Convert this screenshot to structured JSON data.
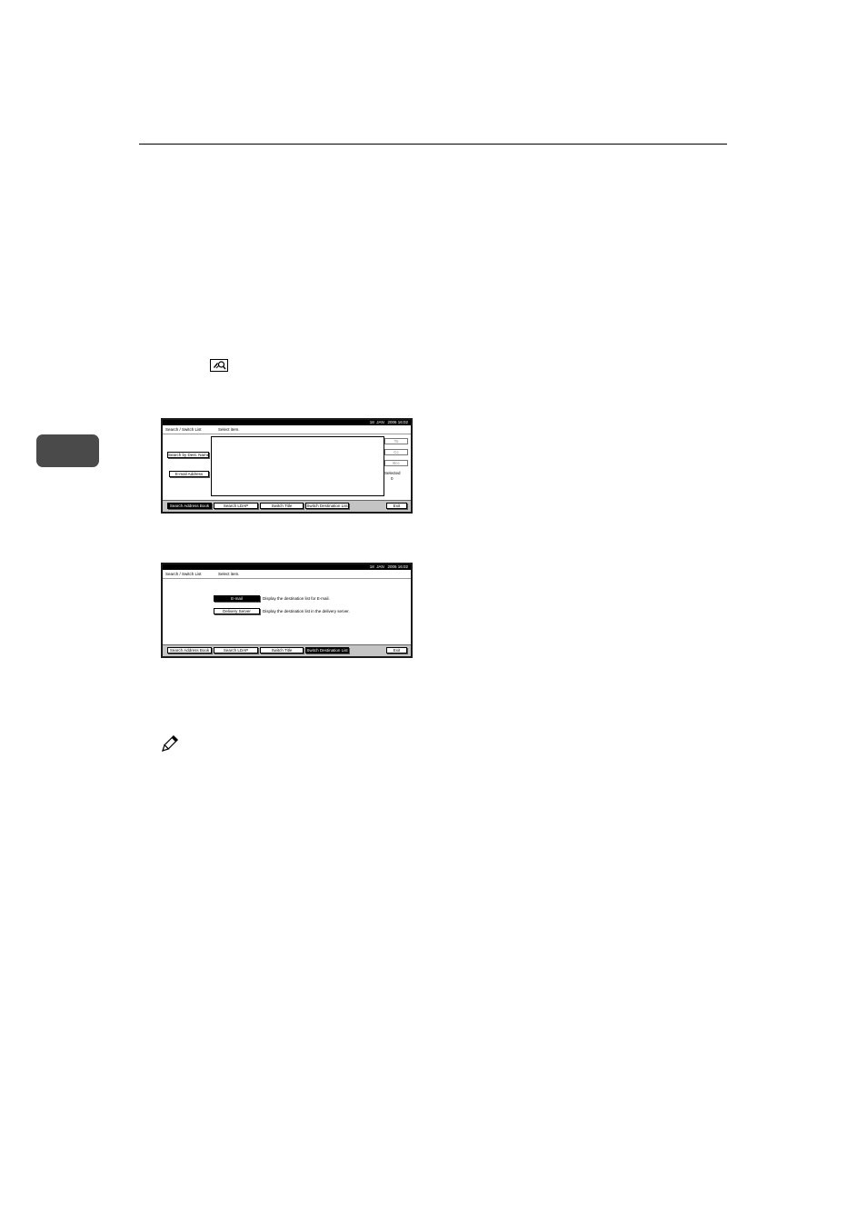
{
  "icons": {
    "search_key": "search-key-icon",
    "note": "pencil-note-icon"
  },
  "colors": {
    "chapter_tab": "#4a4a4a",
    "panel_frame": "#1a1a1a"
  },
  "screen1": {
    "status_time": "18  JAN   2006 16:02",
    "title": "Search / Switch List",
    "instruction": "Select item.",
    "side_buttons": [
      "Search by Dest. Name",
      "E-mail Address"
    ],
    "right_buttons": [
      "To",
      "Cc",
      "Bcc"
    ],
    "selected_label": "Selected",
    "selected_count": "0",
    "tabs": [
      "Search Address Book",
      "Search LDAP",
      "Switch Title",
      "Switch Destination List"
    ],
    "exit": "Exit"
  },
  "screen2": {
    "status_time": "18  JAN   2006 16:02",
    "title": "Search / Switch List",
    "instruction": "Select item.",
    "options": [
      {
        "label": "E-mail",
        "description": "Display the destination list for E-mail."
      },
      {
        "label": "Delivery Server",
        "description": "Display the destination list in the delivery server."
      }
    ],
    "tabs": [
      "Search Address Book",
      "Search LDAP",
      "Switch Title",
      "Switch Destination List"
    ],
    "exit": "Exit"
  }
}
